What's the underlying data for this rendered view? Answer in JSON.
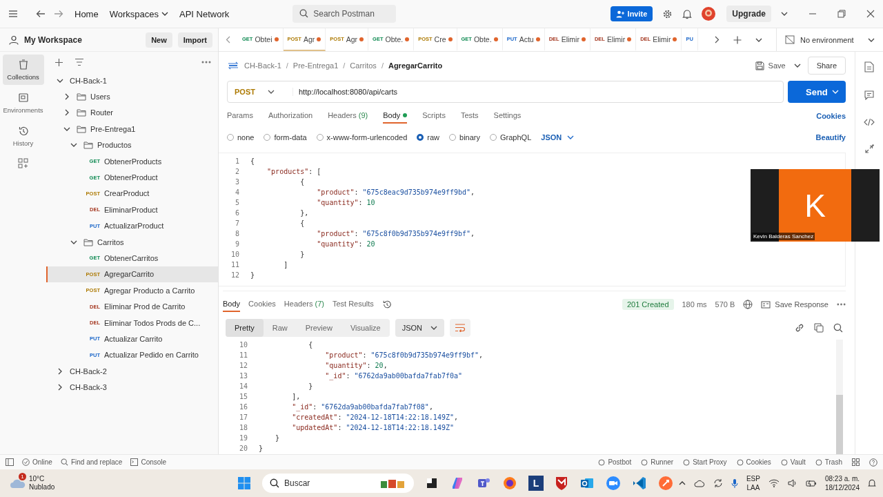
{
  "title_bar": {
    "nav": [
      "Home",
      "Workspaces",
      "API Network"
    ],
    "search": {
      "placeholder": "Search Postman"
    },
    "invite": "Invite",
    "upgrade": "Upgrade"
  },
  "workspace": {
    "name": "My Workspace",
    "new": "New",
    "import": "Import"
  },
  "rail": [
    {
      "kind": "collections",
      "label": "Collections",
      "selected": true
    },
    {
      "kind": "environments",
      "label": "Environments",
      "selected": false
    },
    {
      "kind": "history",
      "label": "History",
      "selected": false
    }
  ],
  "tree": [
    {
      "kind": "collection",
      "name": "CH-Back-1",
      "expanded": true,
      "children": [
        {
          "kind": "folder",
          "name": "Users",
          "expanded": false
        },
        {
          "kind": "folder",
          "name": "Router",
          "expanded": false
        },
        {
          "kind": "folder",
          "name": "Pre-Entrega1",
          "expanded": true,
          "children": [
            {
              "kind": "folder",
              "name": "Productos",
              "expanded": true,
              "children": [
                {
                  "kind": "request",
                  "method": "GET",
                  "name": "ObtenerProducts",
                  "selected": false
                },
                {
                  "kind": "request",
                  "method": "GET",
                  "name": "ObtenerProduct",
                  "selected": false
                },
                {
                  "kind": "request",
                  "method": "POST",
                  "name": "CrearProduct",
                  "selected": false
                },
                {
                  "kind": "request",
                  "method": "DEL",
                  "name": "EliminarProduct",
                  "selected": false
                },
                {
                  "kind": "request",
                  "method": "PUT",
                  "name": "ActualizarProduct",
                  "selected": false
                }
              ]
            },
            {
              "kind": "folder",
              "name": "Carritos",
              "expanded": true,
              "children": [
                {
                  "kind": "request",
                  "method": "GET",
                  "name": "ObtenerCarritos",
                  "selected": false
                },
                {
                  "kind": "request",
                  "method": "POST",
                  "name": "AgregarCarrito",
                  "selected": true
                },
                {
                  "kind": "request",
                  "method": "POST",
                  "name": "Agregar Producto a Carrito",
                  "selected": false
                },
                {
                  "kind": "request",
                  "method": "DEL",
                  "name": "Eliminar Prod de Carrito",
                  "selected": false
                },
                {
                  "kind": "request",
                  "method": "DEL",
                  "name": "Eliminar Todos Prods de C...",
                  "selected": false
                },
                {
                  "kind": "request",
                  "method": "PUT",
                  "name": "Actualizar Carrito",
                  "selected": false
                },
                {
                  "kind": "request",
                  "method": "PUT",
                  "name": "Actualizar Pedido en Carrito",
                  "selected": false
                }
              ]
            }
          ]
        }
      ]
    },
    {
      "kind": "collection",
      "name": "CH-Back-2",
      "expanded": false
    },
    {
      "kind": "collection",
      "name": "CH-Back-3",
      "expanded": false
    }
  ],
  "tabs": [
    {
      "method": "GET",
      "label": "Obtei",
      "unsaved": true,
      "selected": false
    },
    {
      "method": "POST",
      "label": "Agr",
      "unsaved": true,
      "selected": true
    },
    {
      "method": "POST",
      "label": "Agr",
      "unsaved": true,
      "selected": false
    },
    {
      "method": "GET",
      "label": "Obte.",
      "unsaved": true,
      "selected": false
    },
    {
      "method": "POST",
      "label": "Cre",
      "unsaved": true,
      "selected": false
    },
    {
      "method": "GET",
      "label": "Obte.",
      "unsaved": true,
      "selected": false
    },
    {
      "method": "PUT",
      "label": "Actu",
      "unsaved": true,
      "selected": false
    },
    {
      "method": "DEL",
      "label": "Elimir",
      "unsaved": true,
      "selected": false
    },
    {
      "method": "DEL",
      "label": "Elimir",
      "unsaved": true,
      "selected": false
    },
    {
      "method": "DEL",
      "label": "Elimir",
      "unsaved": true,
      "selected": false
    },
    {
      "method": "PU",
      "unsaved": false,
      "selected": false
    }
  ],
  "environment": "No environment",
  "breadcrumb": [
    {
      "label": "CH-Back-1",
      "separator": "/"
    },
    {
      "label": "Pre-Entrega1",
      "separator": "/"
    },
    {
      "label": "Carritos",
      "separator": "/"
    },
    {
      "label": "AgregarCarrito"
    }
  ],
  "save": "Save",
  "share": "Share",
  "request": {
    "method": "POST",
    "url": "http://localhost:8080/api/carts",
    "send": "Send"
  },
  "request_tabs": [
    {
      "label": "Params",
      "selected": false
    },
    {
      "label": "Authorization",
      "selected": false
    },
    {
      "label": "Headers",
      "count": "(9)",
      "selected": false
    },
    {
      "label": "Body",
      "indicator": true,
      "selected": true
    },
    {
      "label": "Scripts",
      "selected": false
    },
    {
      "label": "Tests",
      "selected": false
    },
    {
      "label": "Settings",
      "selected": false
    }
  ],
  "cookies": "Cookies",
  "body_types": [
    {
      "label": "none",
      "selected": false
    },
    {
      "label": "form-data",
      "selected": false
    },
    {
      "label": "x-www-form-urlencoded",
      "selected": false
    },
    {
      "label": "raw",
      "selected": true
    },
    {
      "label": "binary",
      "selected": false
    },
    {
      "label": "GraphQL",
      "selected": false
    }
  ],
  "body_format": "JSON",
  "beautify": "Beautify",
  "request_body": [
    {
      "number": "1",
      "tokens": [
        {
          "kind": "punct",
          "text": "{"
        }
      ]
    },
    {
      "number": "2",
      "tokens": [
        {
          "kind": "key",
          "text": "    \"products\""
        },
        {
          "kind": "punct",
          "text": ": ["
        }
      ]
    },
    {
      "number": "3",
      "tokens": [
        {
          "kind": "punct",
          "text": "            {"
        }
      ]
    },
    {
      "number": "4",
      "tokens": [
        {
          "kind": "key",
          "text": "                \"product\""
        },
        {
          "kind": "punct",
          "text": ": "
        },
        {
          "kind": "string",
          "text": "\"675c8eac9d735b974e9ff9bd\""
        },
        {
          "kind": "punct",
          "text": ","
        }
      ]
    },
    {
      "number": "5",
      "tokens": [
        {
          "kind": "key",
          "text": "                \"quantity\""
        },
        {
          "kind": "punct",
          "text": ": "
        },
        {
          "kind": "number",
          "text": "10"
        }
      ]
    },
    {
      "number": "6",
      "tokens": [
        {
          "kind": "punct",
          "text": "            },"
        }
      ]
    },
    {
      "number": "7",
      "tokens": [
        {
          "kind": "punct",
          "text": "            {"
        }
      ]
    },
    {
      "number": "8",
      "tokens": [
        {
          "kind": "key",
          "text": "                \"product\""
        },
        {
          "kind": "punct",
          "text": ": "
        },
        {
          "kind": "string",
          "text": "\"675c8f0b9d735b974e9ff9bf\""
        },
        {
          "kind": "punct",
          "text": ","
        }
      ]
    },
    {
      "number": "9",
      "tokens": [
        {
          "kind": "key",
          "text": "                \"quantity\""
        },
        {
          "kind": "punct",
          "text": ": "
        },
        {
          "kind": "number",
          "text": "20"
        }
      ]
    },
    {
      "number": "10",
      "tokens": [
        {
          "kind": "punct",
          "text": "            }"
        }
      ]
    },
    {
      "number": "11",
      "tokens": [
        {
          "kind": "punct",
          "text": "        ]"
        }
      ]
    },
    {
      "number": "12",
      "tokens": [
        {
          "kind": "punct",
          "text": "}"
        }
      ]
    }
  ],
  "video_tile": {
    "initial": "K",
    "name": "Kevin Balderas Sanchez"
  },
  "response_tabs": [
    {
      "label": "Body",
      "selected": true
    },
    {
      "label": "Cookies",
      "selected": false
    },
    {
      "label": "Headers",
      "count": "(7)",
      "selected": false
    },
    {
      "label": "Test Results",
      "selected": false
    }
  ],
  "response_status": "201 Created",
  "response_time": "180 ms",
  "response_size": "570 B",
  "save_response": "Save Response",
  "view_modes": [
    {
      "label": "Pretty",
      "selected": true
    },
    {
      "label": "Raw",
      "selected": false
    },
    {
      "label": "Preview",
      "selected": false
    },
    {
      "label": "Visualize",
      "selected": false
    }
  ],
  "response_format": "JSON",
  "response_body": [
    {
      "number": "10",
      "tokens": [
        {
          "kind": "punct",
          "text": "            {"
        }
      ]
    },
    {
      "number": "11",
      "tokens": [
        {
          "kind": "key",
          "text": "                \"product\""
        },
        {
          "kind": "punct",
          "text": ": "
        },
        {
          "kind": "string",
          "text": "\"675c8f0b9d735b974e9ff9bf\""
        },
        {
          "kind": "punct",
          "text": ","
        }
      ]
    },
    {
      "number": "12",
      "tokens": [
        {
          "kind": "key",
          "text": "                \"quantity\""
        },
        {
          "kind": "punct",
          "text": ": "
        },
        {
          "kind": "number",
          "text": "20"
        },
        {
          "kind": "punct",
          "text": ","
        }
      ]
    },
    {
      "number": "13",
      "tokens": [
        {
          "kind": "key",
          "text": "                \"_id\""
        },
        {
          "kind": "punct",
          "text": ": "
        },
        {
          "kind": "string",
          "text": "\"6762da9ab00bafda7fab7f0a\""
        }
      ]
    },
    {
      "number": "14",
      "tokens": [
        {
          "kind": "punct",
          "text": "            }"
        }
      ]
    },
    {
      "number": "15",
      "tokens": [
        {
          "kind": "punct",
          "text": "        ],"
        }
      ]
    },
    {
      "number": "16",
      "tokens": [
        {
          "kind": "key",
          "text": "        \"_id\""
        },
        {
          "kind": "punct",
          "text": ": "
        },
        {
          "kind": "string",
          "text": "\"6762da9ab00bafda7fab7f08\""
        },
        {
          "kind": "punct",
          "text": ","
        }
      ]
    },
    {
      "number": "17",
      "tokens": [
        {
          "kind": "key",
          "text": "        \"createdAt\""
        },
        {
          "kind": "punct",
          "text": ": "
        },
        {
          "kind": "string",
          "text": "\"2024-12-18T14:22:18.149Z\""
        },
        {
          "kind": "punct",
          "text": ","
        }
      ]
    },
    {
      "number": "18",
      "tokens": [
        {
          "kind": "key",
          "text": "        \"updatedAt\""
        },
        {
          "kind": "punct",
          "text": ": "
        },
        {
          "kind": "string",
          "text": "\"2024-12-18T14:22:18.149Z\""
        }
      ]
    },
    {
      "number": "19",
      "tokens": [
        {
          "kind": "punct",
          "text": "    }"
        }
      ]
    },
    {
      "number": "20",
      "tokens": [
        {
          "kind": "punct",
          "text": "}"
        }
      ]
    }
  ],
  "status_bar": {
    "left": [
      "Online",
      "Find and replace",
      "Console"
    ],
    "right": [
      "Postbot",
      "Runner",
      "Start Proxy",
      "Cookies",
      "Vault",
      "Trash"
    ]
  },
  "taskbar": {
    "temperature": "10°C",
    "condition": "Nublado",
    "badge": "1",
    "search": {
      "placeholder": "Buscar"
    },
    "letter_app": "L",
    "language": "ESP",
    "layout": "LAA",
    "time": "08:23 a. m.",
    "date": "18/12/2024"
  }
}
